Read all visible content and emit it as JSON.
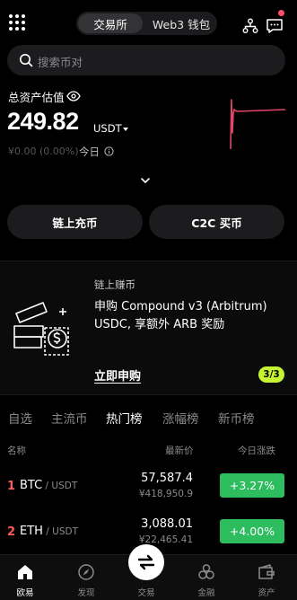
{
  "header": {
    "segments": [
      {
        "label": "交易所",
        "active": true
      },
      {
        "label": "Web3 钱包",
        "active": false
      }
    ],
    "notification_dot_color": "#ff4d6a"
  },
  "search": {
    "placeholder": "搜索币对"
  },
  "assets": {
    "label": "总资产估值",
    "value": "249.82",
    "unit": "USDT",
    "pnl": "¥0.00 (0.00%)",
    "pnl_period": "今日",
    "sparkline_color": "#e0456b"
  },
  "actions": {
    "onchain_deposit": "链上充币",
    "c2c_buy": "C2C 买币"
  },
  "promo": {
    "tag": "链上赚币",
    "title": "申购 Compound v3 (Arbitrum) USDC, 享额外 ARB 奖励",
    "cta": "立即申购",
    "page": "3/3",
    "page_badge_color": "#c6f432"
  },
  "market_tabs": [
    {
      "label": "自选",
      "active": false
    },
    {
      "label": "主流币",
      "active": false
    },
    {
      "label": "热门榜",
      "active": true
    },
    {
      "label": "涨幅榜",
      "active": false
    },
    {
      "label": "新币榜",
      "active": false
    }
  ],
  "table_header": {
    "name": "名称",
    "price": "最新价",
    "change": "今日涨跌"
  },
  "rows": [
    {
      "rank": "1",
      "base": "BTC",
      "quote": " / USDT",
      "price": "57,587.4",
      "price_cny": "¥418,950.9",
      "change": "+3.27%"
    },
    {
      "rank": "2",
      "base": "ETH",
      "quote": " / USDT",
      "price": "3,088.01",
      "price_cny": "¥22,465.41",
      "change": "+4.00%"
    }
  ],
  "colors": {
    "up": "#2dbd5f",
    "rank": "#ff5b5b"
  },
  "bottom_nav": [
    {
      "label": "欧易",
      "icon": "home-icon",
      "active": true
    },
    {
      "label": "发现",
      "icon": "discover-icon",
      "active": false
    },
    {
      "label": "交易",
      "icon": "trade-swap-icon",
      "active": false
    },
    {
      "label": "金融",
      "icon": "finance-icon",
      "active": false
    },
    {
      "label": "资产",
      "icon": "wallet-icon",
      "active": false
    }
  ]
}
